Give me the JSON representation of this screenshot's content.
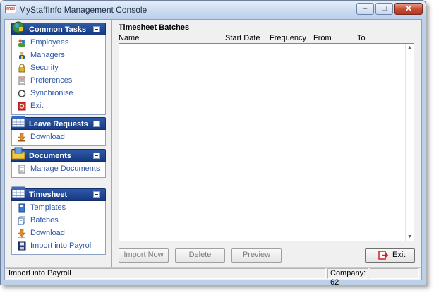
{
  "window": {
    "title": "MyStaffInfo Management Console",
    "icon_text": "msi",
    "controls": [
      "minimize",
      "maximize",
      "close"
    ]
  },
  "sidebar": {
    "groups": [
      {
        "title": "Common Tasks",
        "icon": "common-tasks-icon",
        "items": [
          {
            "label": "Employees",
            "icon": "employees-icon"
          },
          {
            "label": "Managers",
            "icon": "managers-icon"
          },
          {
            "label": "Security",
            "icon": "lock-icon"
          },
          {
            "label": "Preferences",
            "icon": "preferences-icon"
          },
          {
            "label": "Synchronise",
            "icon": "sync-icon"
          },
          {
            "label": "Exit",
            "icon": "exit-icon"
          }
        ]
      },
      {
        "title": "Leave Requests",
        "icon": "calendar-icon",
        "items": [
          {
            "label": "Download",
            "icon": "download-icon"
          }
        ]
      },
      {
        "title": "Documents",
        "icon": "documents-icon",
        "items": [
          {
            "label": "Manage Documents",
            "icon": "document-icon"
          }
        ]
      },
      {
        "title": "Timesheet",
        "icon": "calendar-icon",
        "items": [
          {
            "label": "Templates",
            "icon": "templates-icon"
          },
          {
            "label": "Batches",
            "icon": "batches-icon"
          },
          {
            "label": "Download",
            "icon": "download-icon"
          },
          {
            "label": "Import into Payroll",
            "icon": "save-icon"
          }
        ]
      }
    ]
  },
  "main": {
    "section_title": "Timesheet Batches",
    "columns": [
      "Name",
      "Start Date",
      "Frequency",
      "From",
      "To"
    ],
    "rows": [],
    "buttons": {
      "import_now": "Import Now",
      "delete": "Delete",
      "preview": "Preview",
      "exit": "Exit"
    }
  },
  "statusbar": {
    "message": "Import into Payroll",
    "company": "Company: 62",
    "extra": ""
  },
  "colors": {
    "group_header": "#1f4694",
    "link": "#2d56a6",
    "disabled_text": "#7c7c7c",
    "exit_icon": "#d0202a"
  }
}
